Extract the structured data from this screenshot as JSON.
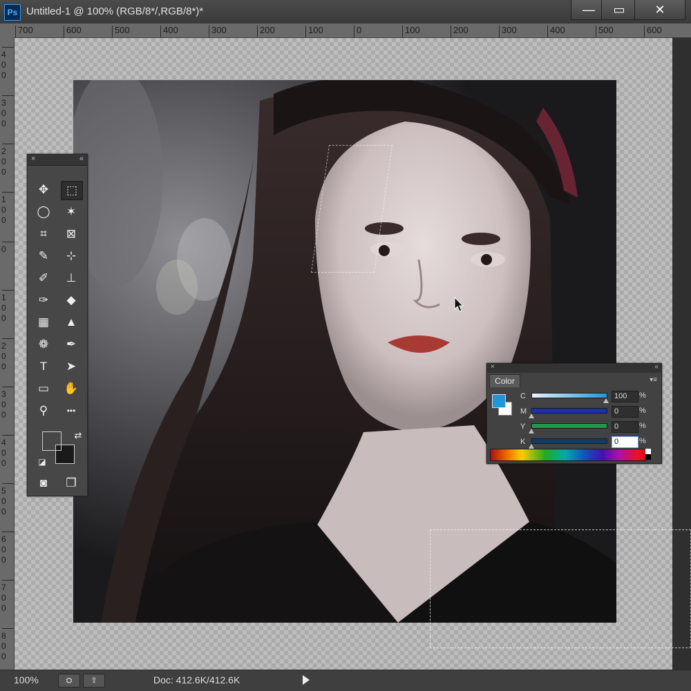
{
  "app": {
    "logo_text": "Ps"
  },
  "document": {
    "title": "Untitled-1 @ 100% (RGB/8*/,RGB/8*)*"
  },
  "window_controls": {
    "minimize": "—",
    "maximize": "▭",
    "close": "✕"
  },
  "ruler": {
    "top_labels": [
      "700",
      "600",
      "500",
      "400",
      "300",
      "200",
      "100",
      "0",
      "100",
      "200",
      "300",
      "400",
      "500",
      "600"
    ],
    "left_labels": [
      "4 0 0",
      "3 0 0",
      "2 0 0",
      "1 0 0",
      "0",
      "1 0 0",
      "2 0 0",
      "3 0 0",
      "4 0 0",
      "5 0 0",
      "6 0 0",
      "7 0 0",
      "8 0 0"
    ]
  },
  "tools_panel": {
    "close_glyph": "×",
    "collapse_glyph": "«",
    "tools": [
      {
        "name": "move-tool",
        "glyph": "✥"
      },
      {
        "name": "marquee-tool",
        "glyph": "⬚",
        "active": true
      },
      {
        "name": "lasso-tool",
        "glyph": "◯"
      },
      {
        "name": "magic-wand-tool",
        "glyph": "✶"
      },
      {
        "name": "crop-tool",
        "glyph": "⌗"
      },
      {
        "name": "frame-tool",
        "glyph": "⊠"
      },
      {
        "name": "eyedropper-tool",
        "glyph": "✎"
      },
      {
        "name": "healing-tool",
        "glyph": "⊹"
      },
      {
        "name": "brush-tool",
        "glyph": "✐"
      },
      {
        "name": "stamp-tool",
        "glyph": "⊥"
      },
      {
        "name": "history-brush-tool",
        "glyph": "✑"
      },
      {
        "name": "eraser-tool",
        "glyph": "◆"
      },
      {
        "name": "gradient-tool",
        "glyph": "▦"
      },
      {
        "name": "blur-tool",
        "glyph": "▲"
      },
      {
        "name": "dodge-tool",
        "glyph": "❁"
      },
      {
        "name": "pen-tool",
        "glyph": "✒"
      },
      {
        "name": "type-tool",
        "glyph": "T"
      },
      {
        "name": "path-selection-tool",
        "glyph": "➤"
      },
      {
        "name": "shape-tool",
        "glyph": "▭"
      },
      {
        "name": "hand-tool",
        "glyph": "✋"
      },
      {
        "name": "zoom-tool",
        "glyph": "⚲"
      },
      {
        "name": "more-tools",
        "glyph": "•••"
      }
    ],
    "swap_glyph": "⇄",
    "default_colors_glyph": "◪",
    "quick_mask_glyph": "◙",
    "screen_mode_glyph": "❐"
  },
  "color_panel": {
    "close_glyph": "×",
    "collapse_glyph": "«",
    "tab_label": "Color",
    "menu_glyph": "▾≡",
    "foreground_color": "#1f97d6",
    "background_color": "#ffffff",
    "channels": [
      {
        "label": "C",
        "value": "100",
        "pct": "%",
        "level": 1.0,
        "fill": "#1f97d6"
      },
      {
        "label": "M",
        "value": "0",
        "pct": "%",
        "level": 0.0,
        "fill": "#1a2fb8"
      },
      {
        "label": "Y",
        "value": "0",
        "pct": "%",
        "level": 0.0,
        "fill": "#1e9a4a"
      },
      {
        "label": "K",
        "value": "0",
        "pct": "%",
        "level": 0.0,
        "fill": "#0d3d66"
      }
    ]
  },
  "status_bar": {
    "zoom": "100%",
    "doc_info": "Doc: 412.6K/412.6K",
    "icon1": "⛭",
    "icon2": "⇪"
  }
}
